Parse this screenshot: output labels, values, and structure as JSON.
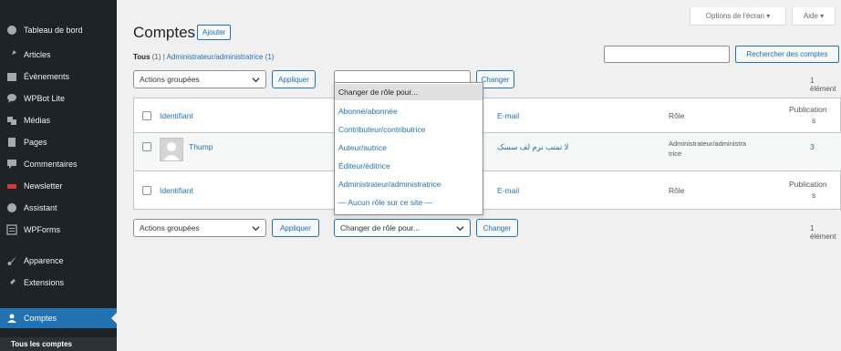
{
  "sidebar": {
    "items": [
      {
        "label": "Tableau de bord",
        "icon": "dashboard-icon"
      },
      {
        "label": "Articles",
        "icon": "pin-icon"
      },
      {
        "label": "Évènements",
        "icon": "calendar-icon"
      },
      {
        "label": "WPBot Lite",
        "icon": "chat-icon"
      },
      {
        "label": "Médias",
        "icon": "media-icon"
      },
      {
        "label": "Pages",
        "icon": "pages-icon"
      },
      {
        "label": "Commentaires",
        "icon": "comment-icon"
      },
      {
        "label": "Newsletter",
        "icon": "newsletter-icon"
      },
      {
        "label": "Assistant",
        "icon": "assistant-icon"
      },
      {
        "label": "WPForms",
        "icon": "forms-icon"
      },
      {
        "label": "Apparence",
        "icon": "brush-icon"
      },
      {
        "label": "Extensions",
        "icon": "plugin-icon"
      },
      {
        "label": "Comptes",
        "icon": "users-icon"
      }
    ],
    "submenu": {
      "label": "Tous les comptes"
    }
  },
  "header": {
    "screen_options": "Options de l'écran ▾",
    "help": "Aide ▾",
    "title": "Comptes",
    "add_label": "Ajouter"
  },
  "filters": {
    "all": "Tous",
    "all_count": "(1)",
    "sep": "|",
    "admin": "Administrateur/administratrice (1)"
  },
  "search": {
    "button": "Rechercher des comptes",
    "placeholder": ""
  },
  "bulk_top": {
    "select": "Actions groupées",
    "apply": "Appliquer",
    "role_select": "Changer de rôle pour...",
    "change": "Changer",
    "count": "1 élément"
  },
  "bulk_bottom": {
    "select": "Actions groupées",
    "apply": "Appliquer",
    "role_select": "Changer de rôle pour...",
    "change": "Changer",
    "count": "1 élément"
  },
  "table": {
    "header": {
      "username": "Identifiant",
      "email": "E-mail",
      "role": "Rôle",
      "posts_line1": "Publication",
      "posts_line2": "s"
    },
    "row": {
      "username": "Thump",
      "email": "لا تمتب نرم لف سسک",
      "role_line1": "Administrateur/administra",
      "role_line2": "trice",
      "posts": "3"
    },
    "footer": {
      "username": "Identifiant",
      "email": "E-mail",
      "role": "Rôle",
      "posts_line1": "Publication",
      "posts_line2": "s"
    }
  },
  "dropdown": {
    "options": [
      "Changer de rôle pour...",
      "Abonné/abonnée",
      "Contributeur/contributrice",
      "Auteur/autrice",
      "Éditeur/éditrice",
      "Administrateur/administratrice",
      "— Aucun rôle sur ce site —"
    ]
  },
  "colors": {
    "accent": "#2271b1",
    "sidebar": "#1d2327",
    "active": "#2271b1"
  }
}
